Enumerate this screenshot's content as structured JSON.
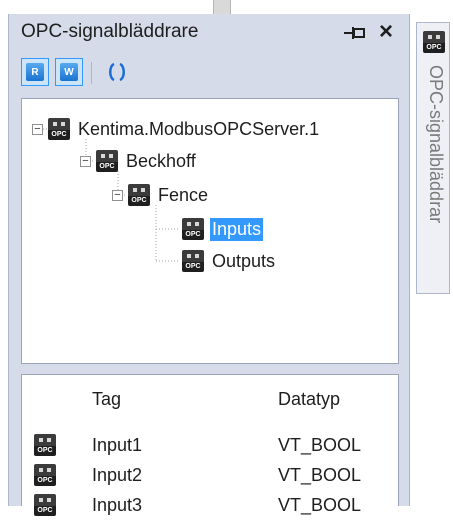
{
  "window": {
    "title": "OPC-signalbläddrare",
    "pin_icon": "pin-icon",
    "close_label": "×"
  },
  "toolbar": {
    "read_label": "R",
    "write_label": "W",
    "refresh_icon": "refresh-icon"
  },
  "tree": {
    "nodes": [
      {
        "label": "Kentima.ModbusOPCServer.1",
        "expander": "−",
        "selected": false
      },
      {
        "label": "Beckhoff",
        "expander": "−",
        "selected": false
      },
      {
        "label": "Fence",
        "expander": "−",
        "selected": false
      },
      {
        "label": "Inputs",
        "expander": "",
        "selected": true
      },
      {
        "label": "Outputs",
        "expander": "",
        "selected": false
      }
    ]
  },
  "list": {
    "columns": {
      "tag": "Tag",
      "type": "Datatyp"
    },
    "rows": [
      {
        "tag": "Input1",
        "type": "VT_BOOL"
      },
      {
        "tag": "Input2",
        "type": "VT_BOOL"
      },
      {
        "tag": "Input3",
        "type": "VT_BOOL"
      }
    ]
  },
  "icon_text": "OPC",
  "side_tab": {
    "label": "OPC-signalbläddrar"
  },
  "colors": {
    "panel_bg": "#d6dbe9",
    "selection": "#3399ff",
    "accent": "#1a73d0"
  }
}
